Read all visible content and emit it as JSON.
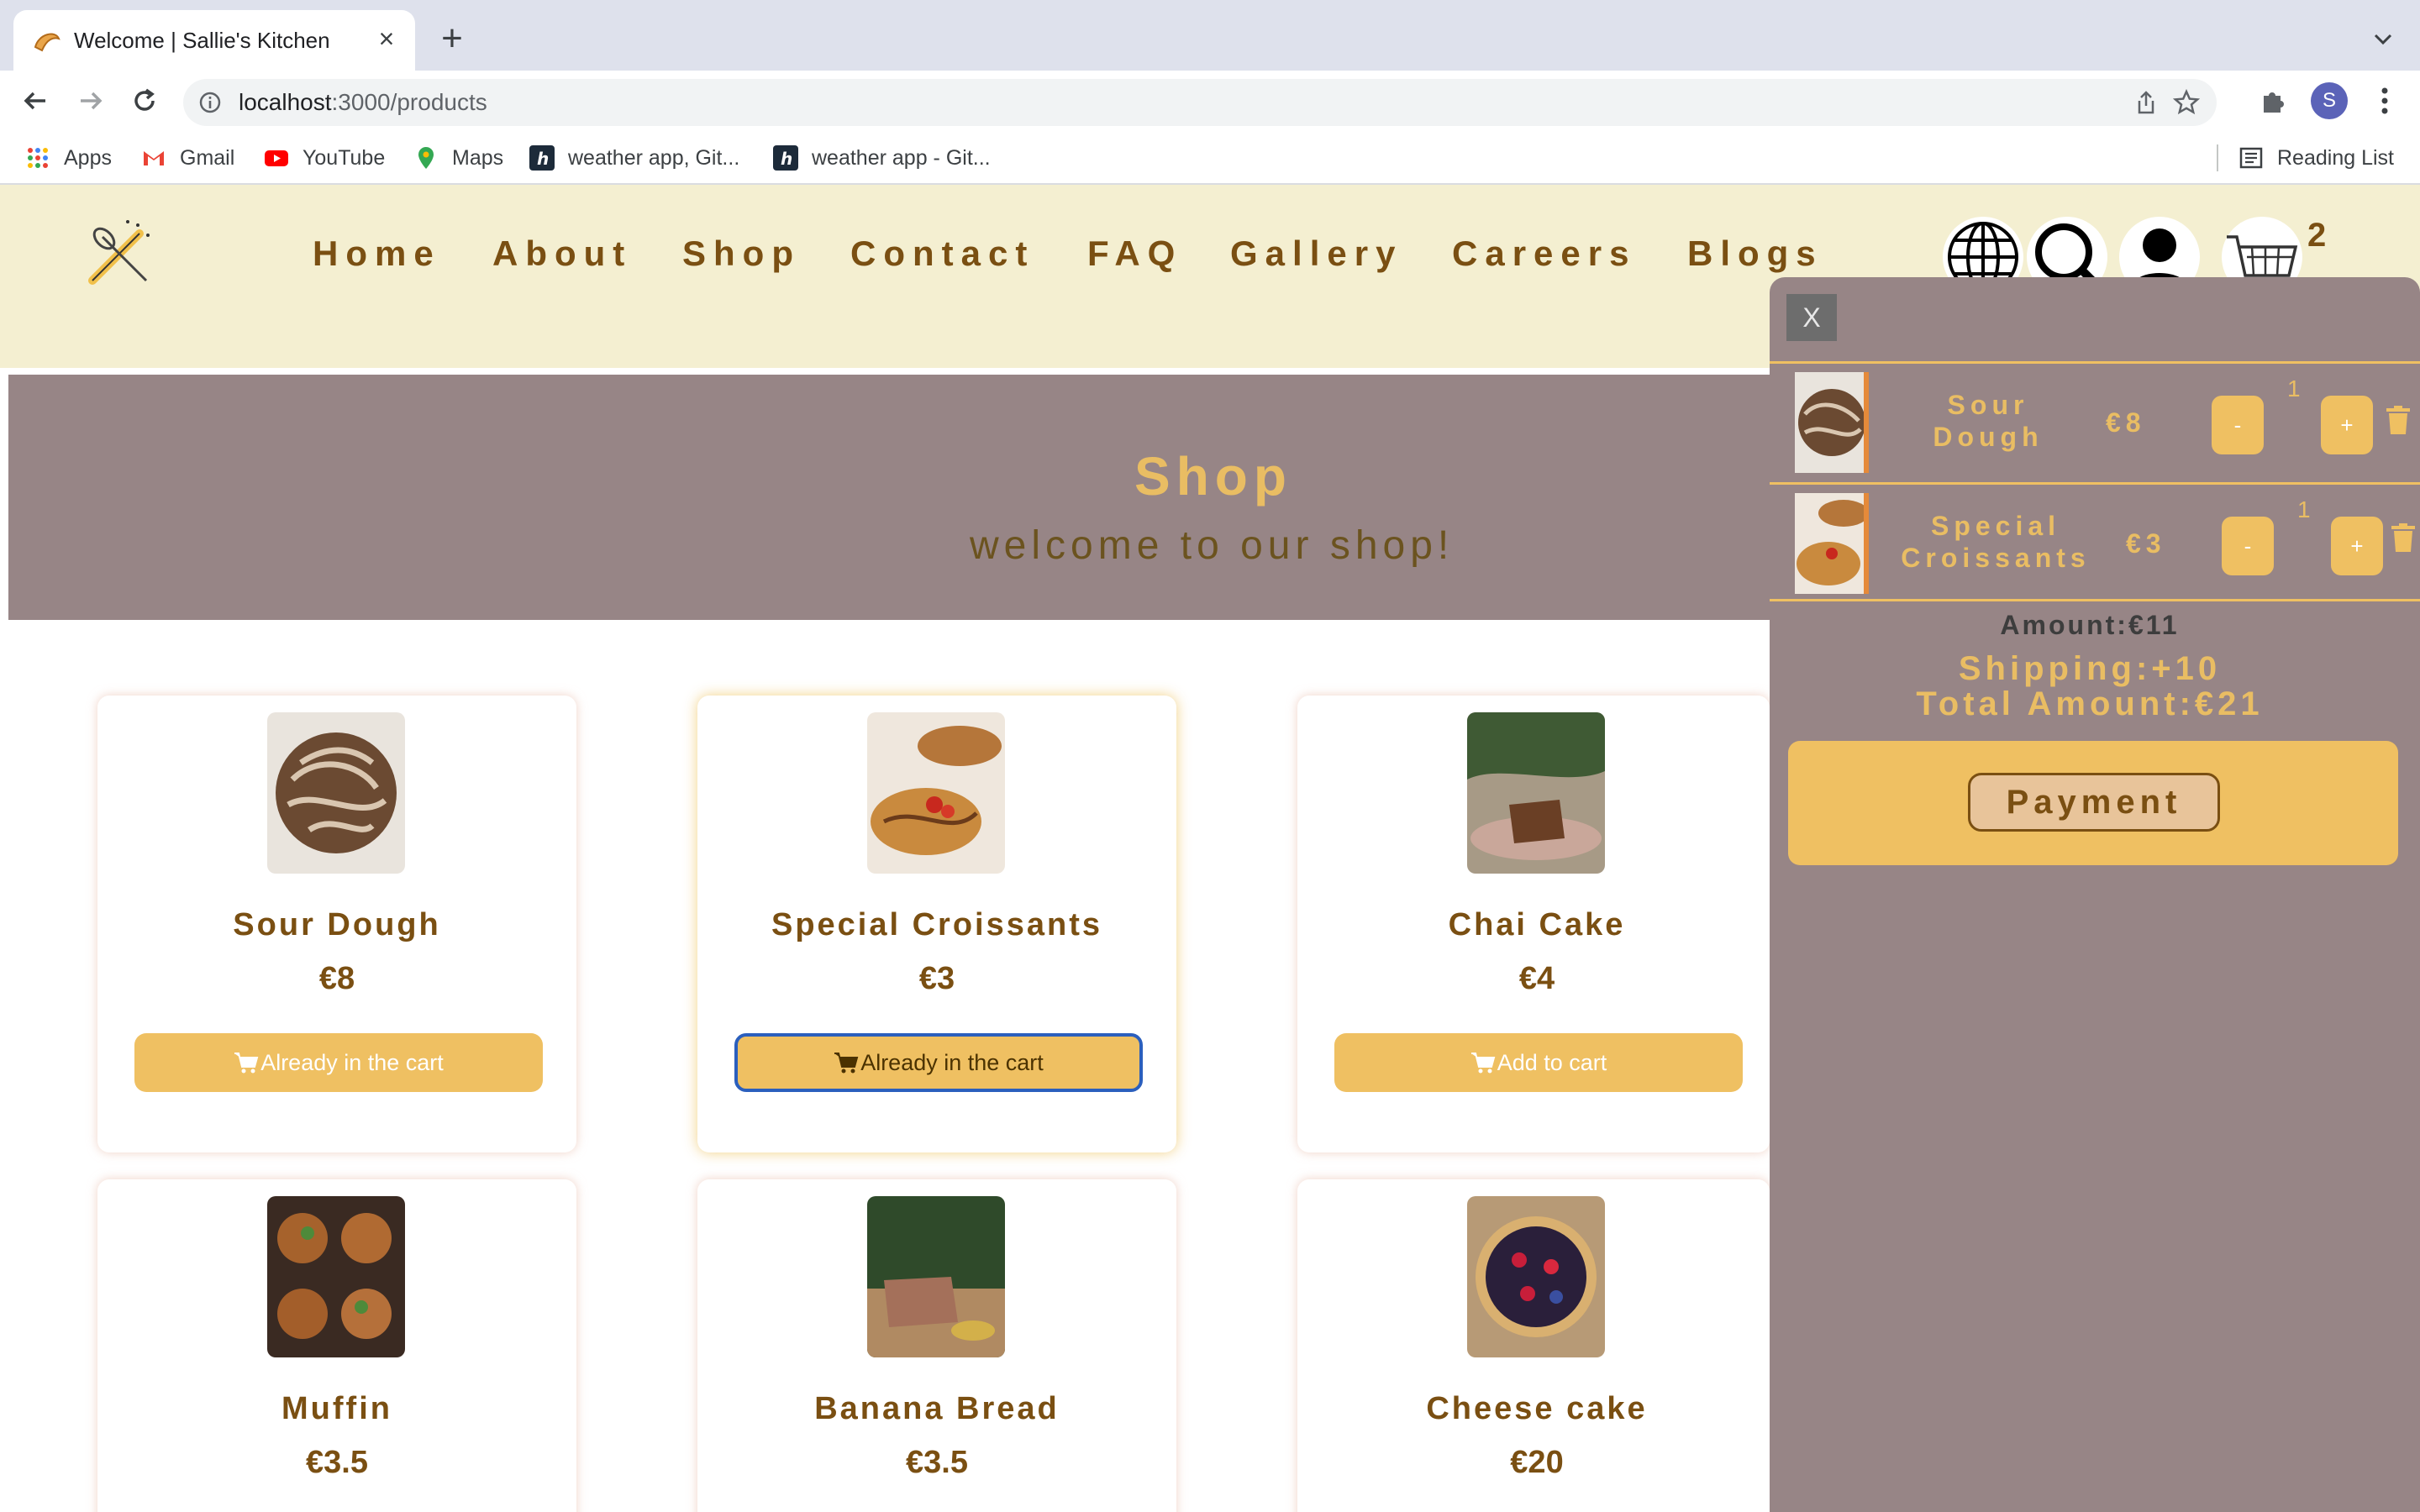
{
  "browser": {
    "tab_title": "Welcome | Sallie's Kitchen",
    "tab_close": "×",
    "new_tab": "+",
    "url_host": "localhost",
    "url_path": ":3000/products",
    "profile_initial": "S",
    "bookmarks": [
      "Apps",
      "Gmail",
      "YouTube",
      "Maps",
      "weather app, Git...",
      "weather app - Git..."
    ],
    "reading_list": "Reading List"
  },
  "header": {
    "nav": [
      "Home",
      "About",
      "Shop",
      "Contact",
      "FAQ",
      "Gallery",
      "Careers",
      "Blogs"
    ],
    "cart_count": "2",
    "icons": [
      "globe-icon",
      "search-icon",
      "user-icon",
      "cart-icon"
    ]
  },
  "banner": {
    "title": "Shop",
    "subtitle": "welcome to our shop!"
  },
  "products": [
    {
      "name": "Sour Dough",
      "price": "€8",
      "button": "Already in the cart"
    },
    {
      "name": "Special Croissants",
      "price": "€3",
      "button": "Already in the cart"
    },
    {
      "name": "Chai Cake",
      "price": "€4",
      "button": "Add to cart"
    },
    {
      "name": "Muffin",
      "price": "€3.5"
    },
    {
      "name": "Banana Bread",
      "price": "€3.5"
    },
    {
      "name": "Cheese cake",
      "price": "€20"
    }
  ],
  "cart": {
    "close_label": "X",
    "items": [
      {
        "name": "Sour Dough",
        "price": "€8",
        "qty": "1",
        "minus": "-",
        "plus": "+"
      },
      {
        "name": "Special Croissants",
        "price": "€3",
        "qty": "1",
        "minus": "-",
        "plus": "+"
      }
    ],
    "amount": "Amount:€11",
    "shipping": "Shipping:+10",
    "total": "Total Amount:€21",
    "payment_label": "Payment"
  },
  "colors": {
    "header_bg": "#f4efd1",
    "accent": "#efc062",
    "brown": "#7a4f12",
    "banner_bg": "#978586"
  }
}
